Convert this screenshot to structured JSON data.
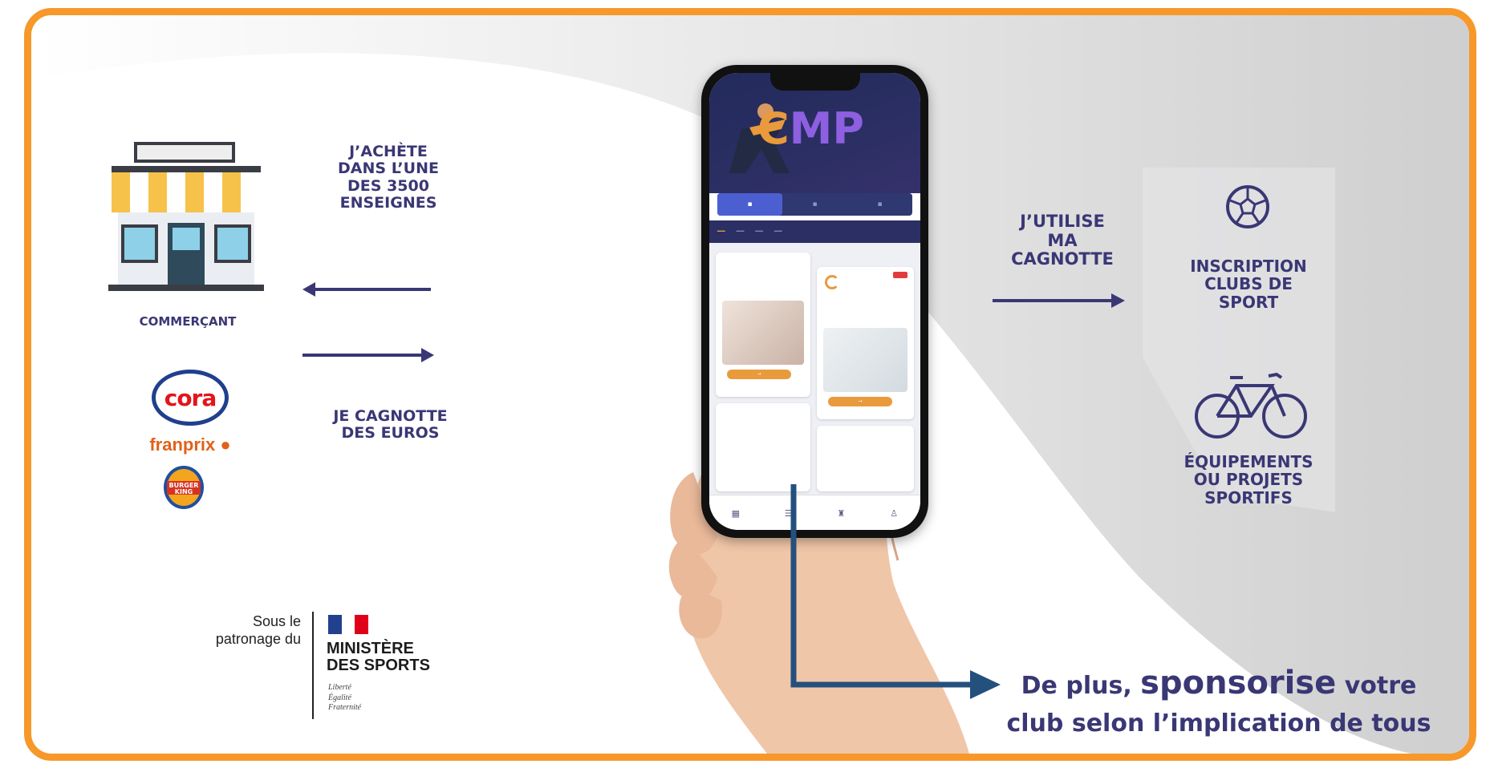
{
  "steps": {
    "buy": [
      "J’ACHÈTE",
      "DANS L’UNE",
      "DES 3500",
      "ENSEIGNES"
    ],
    "merchant_label": "COMMERÇANT",
    "cashback": [
      "JE CAGNOTTE",
      "DES EUROS"
    ],
    "use": [
      "J’UTILISE",
      "MA",
      "CAGNOTTE"
    ],
    "registration": [
      "INSCRIPTION",
      "CLUBS DE",
      "SPORT"
    ],
    "equipment": [
      "ÉQUIPEMENTS",
      "OU PROJETS",
      "SPORTIFS"
    ]
  },
  "brands": {
    "cora": "cora",
    "franprix": "franprix",
    "burger_king": [
      "BURGER",
      "KING"
    ]
  },
  "patronage": {
    "intro": [
      "Sous le",
      "patronage du"
    ],
    "ministry": [
      "MINISTÈRE",
      "DES SPORTS"
    ],
    "motto": [
      "Liberté",
      "Égalité",
      "Fraternité"
    ]
  },
  "sponsor": {
    "prefix": "De plus,",
    "highlight": "sponsorise",
    "suffix": "votre",
    "line2": "club selon l’implication de tous"
  },
  "colors": {
    "frame": "#f7982b",
    "navy": "#3a3775",
    "arrow_blue": "#24507e"
  },
  "icons": {
    "store": "store-icon",
    "registration": "soccer-ball-icon",
    "equipment": "bicycle-icon"
  }
}
